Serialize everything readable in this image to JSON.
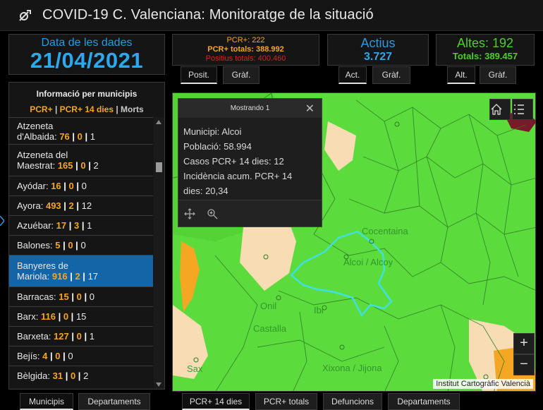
{
  "header": {
    "title": "COVID-19 C. Valenciana: Monitoratge de la situació",
    "logo_icon": "virus-logo-icon"
  },
  "date_panel": {
    "label": "Data de les dades",
    "value": "21/04/2021"
  },
  "pcr_panel": {
    "line1": "PCR+: 222",
    "line2": "PCR+ totals: 388.992",
    "line3": "Positius totals: 400.460",
    "tabs": [
      "Posit.",
      "Gràf."
    ]
  },
  "actius_panel": {
    "label": "Actius",
    "value": "3.727",
    "tabs": [
      "Act.",
      "Gràf."
    ]
  },
  "altes_panel": {
    "label": "Altes: 192",
    "value": "Totals: 389.457",
    "tabs": [
      "Alt.",
      "Gràf."
    ]
  },
  "muni_panel": {
    "heading": "Informació per municipis",
    "legend_a": "PCR+",
    "legend_sep1": " | ",
    "legend_b": "PCR+ 14 dies",
    "legend_sep2": " | ",
    "legend_c": "Morts",
    "items": [
      {
        "name": "Atzeneta",
        "name2": "d'Albaida:",
        "a": "76",
        "b": "0",
        "c": "1"
      },
      {
        "name": "Atzeneta del",
        "name2": "Maestrat:",
        "a": "165",
        "b": "0",
        "c": "2"
      },
      {
        "name": "Ayódar:",
        "name2": "",
        "a": "16",
        "b": "0",
        "c": "0"
      },
      {
        "name": "Ayora:",
        "name2": "",
        "a": "493",
        "b": "2",
        "c": "12"
      },
      {
        "name": "Azuébar:",
        "name2": "",
        "a": "17",
        "b": "3",
        "c": "1"
      },
      {
        "name": "Balones:",
        "name2": "",
        "a": "5",
        "b": "0",
        "c": "0"
      },
      {
        "name": "Banyeres de",
        "name2": "Mariola:",
        "a": "916",
        "b": "2",
        "c": "17"
      },
      {
        "name": "Barracas:",
        "name2": "",
        "a": "15",
        "b": "0",
        "c": "0"
      },
      {
        "name": "Barx:",
        "name2": "",
        "a": "116",
        "b": "0",
        "c": "15"
      },
      {
        "name": "Barxeta:",
        "name2": "",
        "a": "127",
        "b": "0",
        "c": "1"
      },
      {
        "name": "Bejís:",
        "name2": "",
        "a": "4",
        "b": "0",
        "c": "0"
      },
      {
        "name": "Bèlgida:",
        "name2": "",
        "a": "31",
        "b": "0",
        "c": "2"
      }
    ],
    "bottom_tabs": [
      "Municipis",
      "Departaments"
    ]
  },
  "popup": {
    "title": "Mostrando 1",
    "lines": [
      "Municipi: Alcoi",
      "Població: 58.994",
      "Casos PCR+ 14 dies: 12",
      "Incidència acum. PCR+ 14",
      "dies: 20,34"
    ]
  },
  "map": {
    "labels": [
      "Cocentaina",
      "Alcoi / Alcoy",
      "Onil",
      "Ibi",
      "Castalla",
      "Sax",
      "Xixona / Jijona"
    ],
    "zoom_in": "+",
    "zoom_out": "−",
    "credit": "Institut Cartogràfic Valencià",
    "bottom_tabs": [
      "PCR+ 14 dies",
      "PCR+ totals",
      "Defuncions",
      "Departaments"
    ],
    "colors": {
      "green": "#5cdc3c",
      "orange": "#f5a623",
      "beige": "#f7dcb4",
      "highlight": "#40e0e0"
    }
  }
}
